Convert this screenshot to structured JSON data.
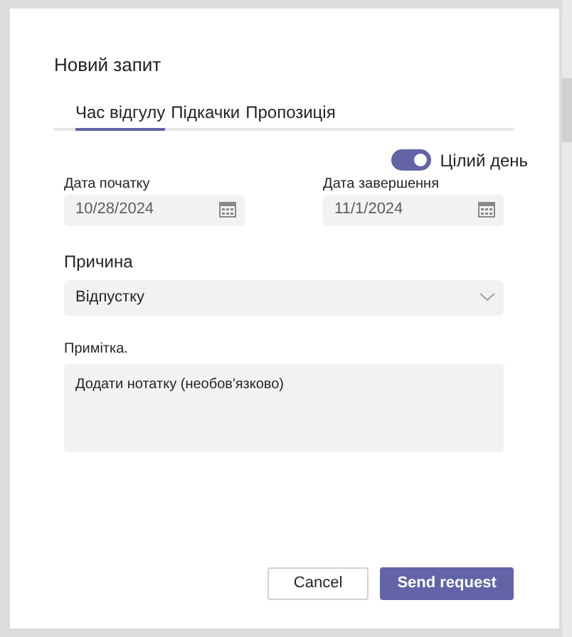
{
  "dialog": {
    "title": "Новий запит"
  },
  "tabs": [
    {
      "label": "Час відгулу",
      "selected": true
    },
    {
      "label": "Підкачки",
      "selected": false
    },
    {
      "label": "Пропозиція",
      "selected": false
    }
  ],
  "all_day": {
    "label": "Цілий день",
    "on": true
  },
  "start_date": {
    "label": "Дата початку",
    "value": "10/28/2024"
  },
  "end_date": {
    "label": "Дата завершення",
    "value": "11/1/2024"
  },
  "reason": {
    "label": "Причина",
    "value": "Відпустку"
  },
  "note": {
    "label": "Примітка.",
    "placeholder": "Додати нотатку (необов'язково)"
  },
  "buttons": [
    {
      "label": "Cancel",
      "kind": "secondary"
    },
    {
      "label": "Send request",
      "kind": "primary"
    }
  ]
}
